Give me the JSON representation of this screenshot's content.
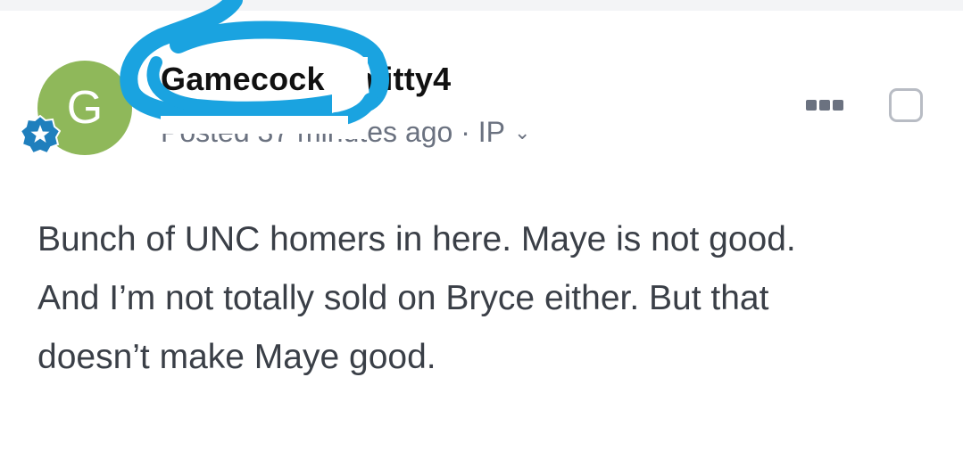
{
  "post": {
    "avatar_letter": "G",
    "author": "Gamecock Smitty4",
    "meta_text": "Posted 37 minutes ago · IP",
    "body_lines": [
      "Bunch of UNC homers in here. Maye is not good.",
      "And I’m not totally sold on Bryce either. But that",
      "doesn’t make Maye good."
    ]
  },
  "icons": {
    "badge": "star-badge-icon",
    "menu": "more-options-icon",
    "chevron": "chevron-down-icon",
    "checkbox": "select-checkbox"
  },
  "colors": {
    "avatar_bg": "#8fb85a",
    "badge_bg": "#1f7fbd",
    "scribble": "#1aa3e0",
    "meta_text": "#6b7280",
    "body_text": "#3a3f47"
  }
}
